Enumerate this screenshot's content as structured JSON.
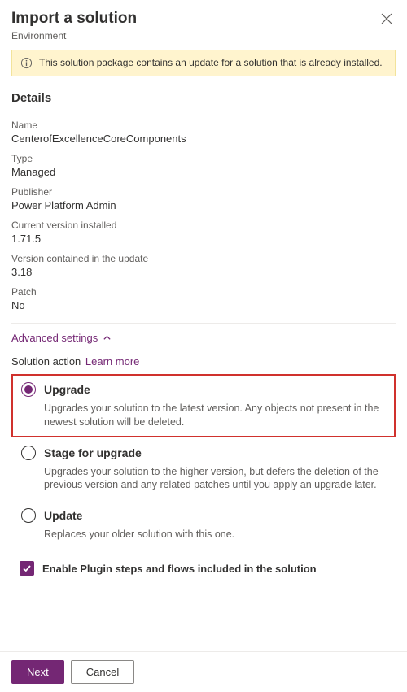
{
  "header": {
    "title": "Import a solution",
    "subtitle": "Environment"
  },
  "banner": {
    "message": "This solution package contains an update for a solution that is already installed."
  },
  "details": {
    "heading": "Details",
    "name_label": "Name",
    "name_value": "CenterofExcellenceCoreComponents",
    "type_label": "Type",
    "type_value": "Managed",
    "publisher_label": "Publisher",
    "publisher_value": "Power Platform Admin",
    "current_version_label": "Current version installed",
    "current_version_value": "1.71.5",
    "update_version_label": "Version contained in the update",
    "update_version_value": "3.18",
    "patch_label": "Patch",
    "patch_value": "No"
  },
  "advanced": {
    "toggle_label": "Advanced settings",
    "action_label": "Solution action",
    "learn_more": "Learn more",
    "options": [
      {
        "key": "upgrade",
        "title": "Upgrade",
        "desc": "Upgrades your solution to the latest version. Any objects not present in the newest solution will be deleted.",
        "selected": true,
        "highlight": true
      },
      {
        "key": "stage",
        "title": "Stage for upgrade",
        "desc": "Upgrades your solution to the higher version, but defers the deletion of the previous version and any related patches until you apply an upgrade later.",
        "selected": false,
        "highlight": false
      },
      {
        "key": "update",
        "title": "Update",
        "desc": "Replaces your older solution with this one.",
        "selected": false,
        "highlight": false
      }
    ],
    "checkbox_label": "Enable Plugin steps and flows included in the solution",
    "checkbox_checked": true
  },
  "footer": {
    "next": "Next",
    "cancel": "Cancel"
  }
}
